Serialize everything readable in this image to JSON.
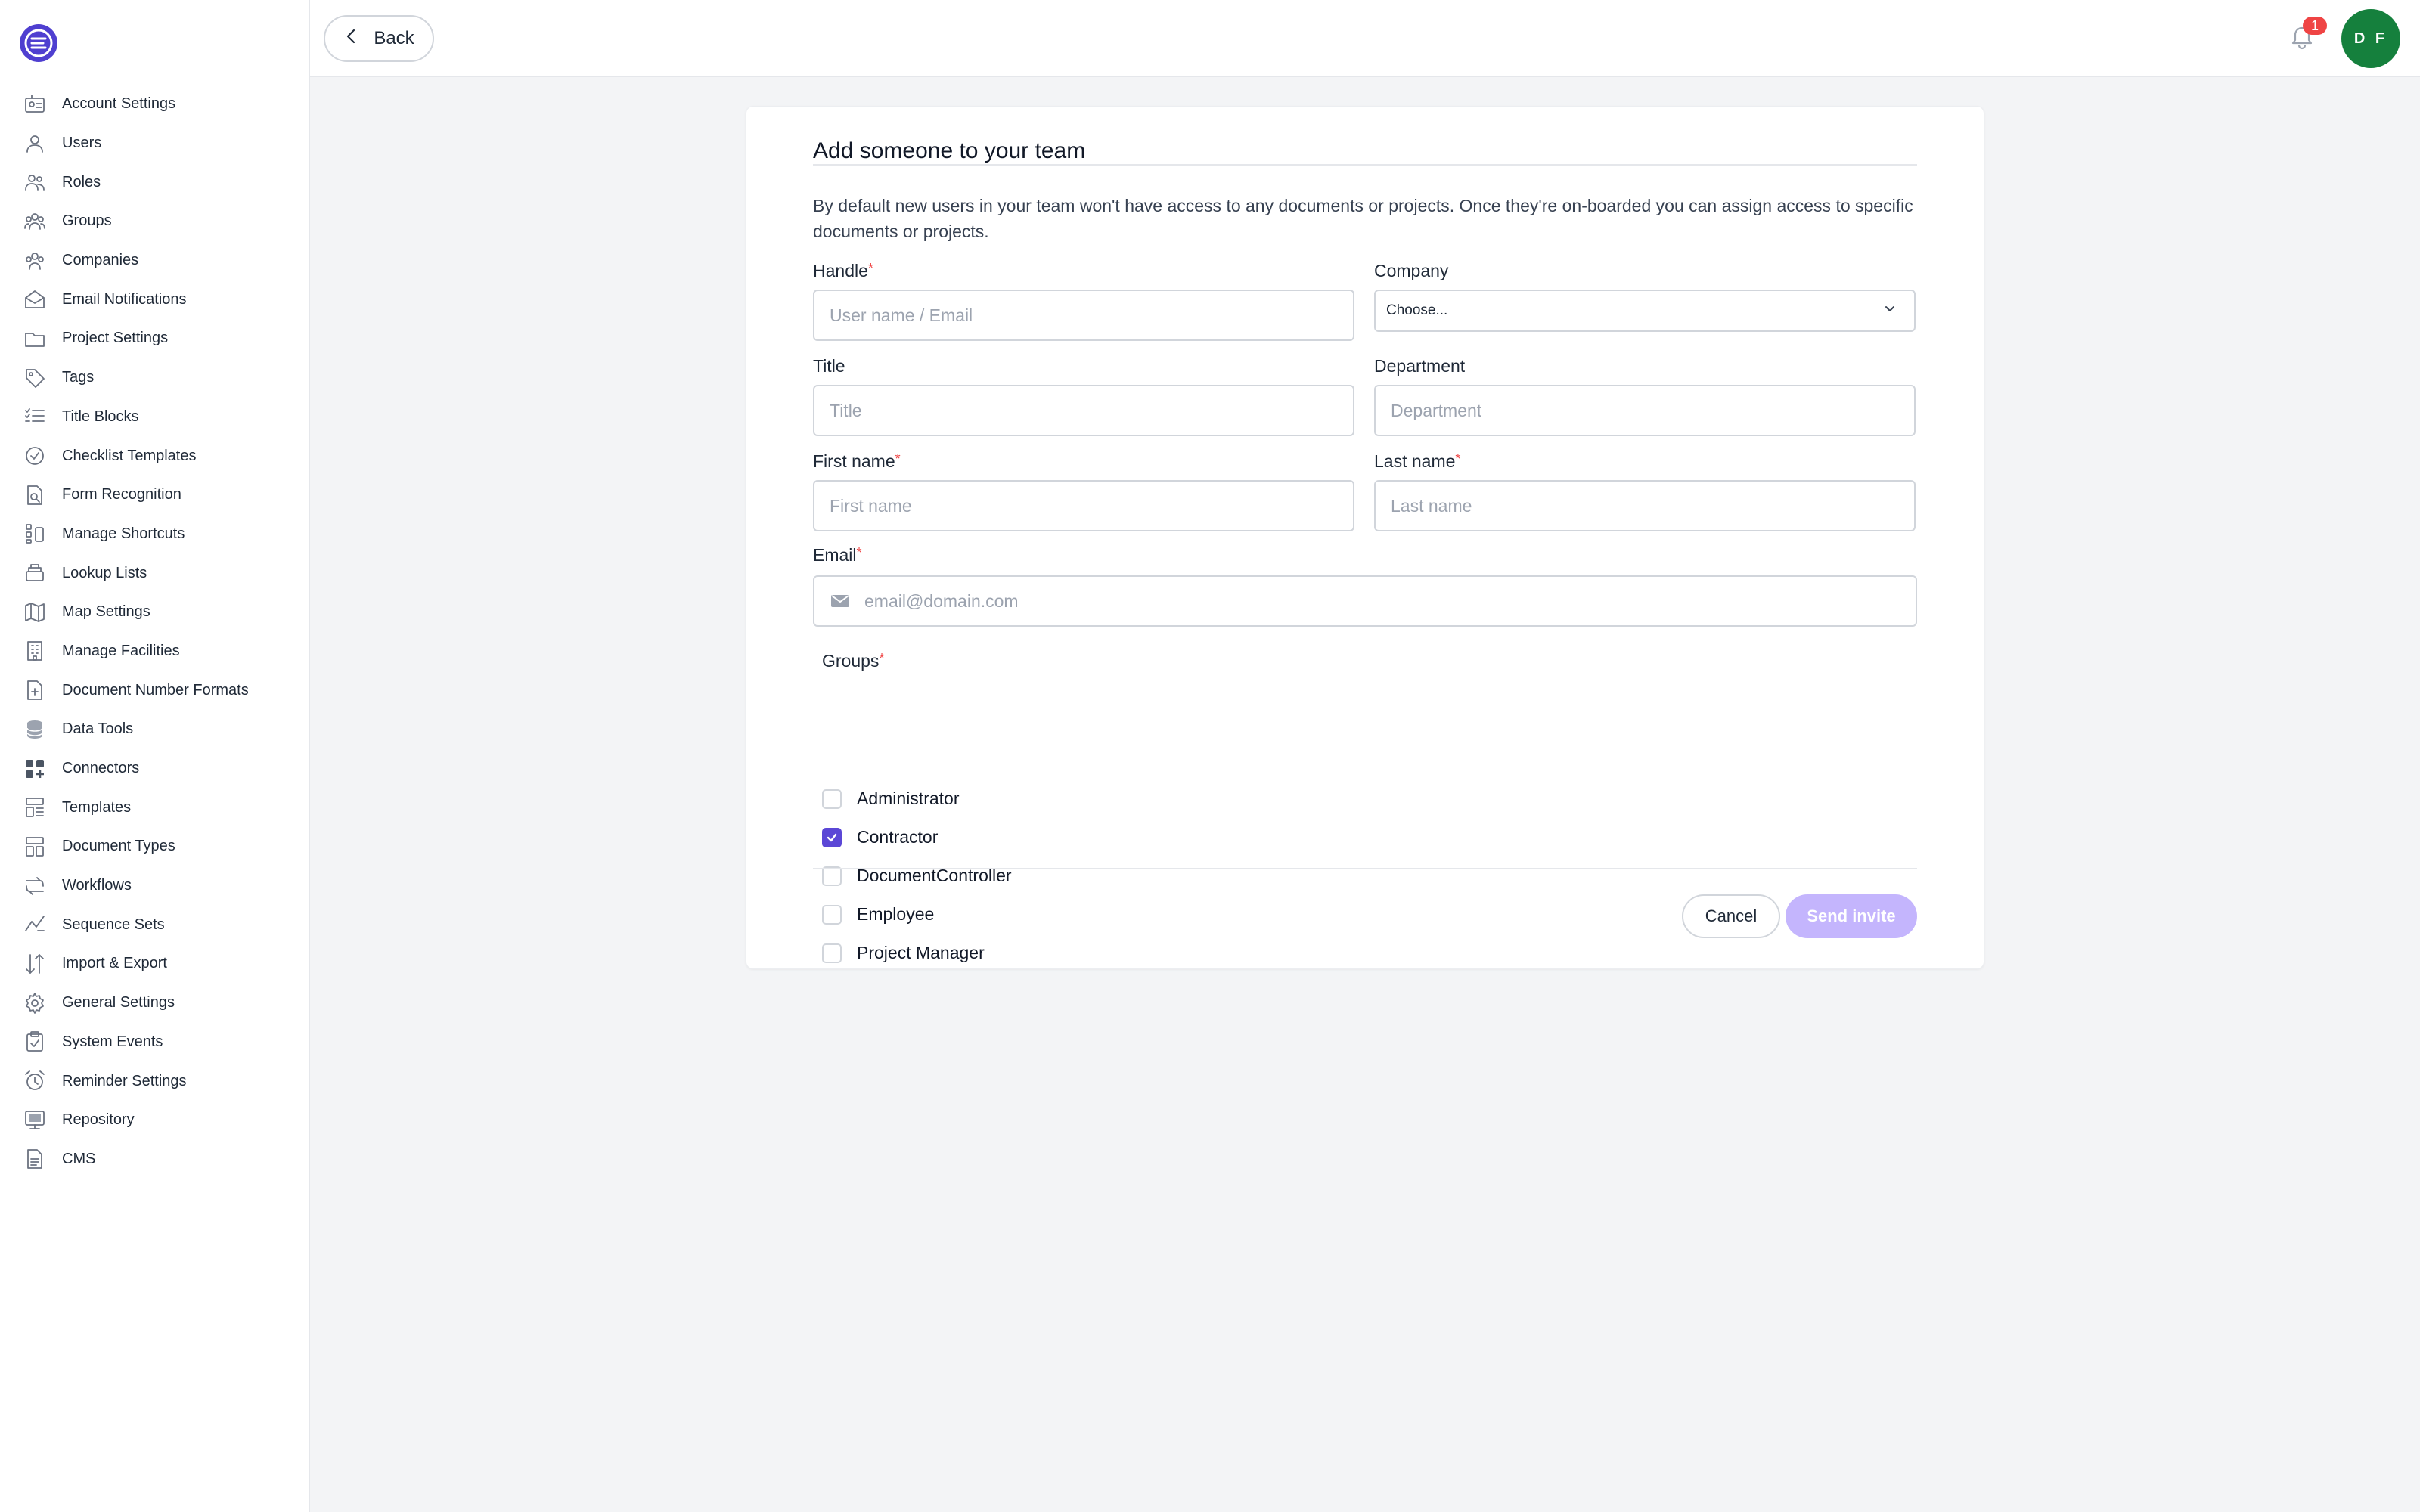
{
  "sidebar": {
    "items": [
      {
        "label": "Account Settings",
        "icon": "id-card-icon"
      },
      {
        "label": "Users",
        "icon": "user-icon"
      },
      {
        "label": "Roles",
        "icon": "users-icon"
      },
      {
        "label": "Groups",
        "icon": "users-group-icon"
      },
      {
        "label": "Companies",
        "icon": "building-users-icon"
      },
      {
        "label": "Email Notifications",
        "icon": "envelope-open-icon"
      },
      {
        "label": "Project Settings",
        "icon": "folder-icon"
      },
      {
        "label": "Tags",
        "icon": "tag-icon"
      },
      {
        "label": "Title Blocks",
        "icon": "list-check-icon"
      },
      {
        "label": "Checklist Templates",
        "icon": "check-circle-icon"
      },
      {
        "label": "Form Recognition",
        "icon": "file-search-icon"
      },
      {
        "label": "Manage Shortcuts",
        "icon": "shortcut-icon"
      },
      {
        "label": "Lookup Lists",
        "icon": "layers-icon"
      },
      {
        "label": "Map Settings",
        "icon": "map-icon"
      },
      {
        "label": "Manage Facilities",
        "icon": "building-icon"
      },
      {
        "label": "Document Number Formats",
        "icon": "file-plus-icon"
      },
      {
        "label": "Data Tools",
        "icon": "database-icon"
      },
      {
        "label": "Connectors",
        "icon": "apps-icon"
      },
      {
        "label": "Templates",
        "icon": "template-icon"
      },
      {
        "label": "Document Types",
        "icon": "doc-type-icon"
      },
      {
        "label": "Workflows",
        "icon": "workflow-icon"
      },
      {
        "label": "Sequence Sets",
        "icon": "sequence-icon"
      },
      {
        "label": "Import & Export",
        "icon": "import-export-icon"
      },
      {
        "label": "General Settings",
        "icon": "gear-icon"
      },
      {
        "label": "System Events",
        "icon": "clipboard-check-icon"
      },
      {
        "label": "Reminder Settings",
        "icon": "alarm-clock-icon"
      },
      {
        "label": "Repository",
        "icon": "repository-icon"
      },
      {
        "label": "CMS",
        "icon": "file-text-icon"
      }
    ]
  },
  "topbar": {
    "back_label": "Back",
    "notification_count": "1",
    "avatar_initials": "D F"
  },
  "form": {
    "title": "Add someone to your team",
    "intro": "By default new users in your team won't have access to any documents or projects. Once they're on-boarded you can assign access to specific documents or projects.",
    "handle": {
      "label": "Handle",
      "placeholder": "User name / Email",
      "required": true
    },
    "company": {
      "label": "Company",
      "selected": "Choose..."
    },
    "title_field": {
      "label": "Title",
      "placeholder": "Title"
    },
    "department": {
      "label": "Department",
      "placeholder": "Department"
    },
    "first_name": {
      "label": "First name",
      "placeholder": "First name",
      "required": true
    },
    "last_name": {
      "label": "Last name",
      "placeholder": "Last name",
      "required": true
    },
    "email": {
      "label": "Email",
      "placeholder": "email@domain.com",
      "required": true
    },
    "groups": {
      "label": "Groups",
      "options": [
        {
          "label": "Administrator",
          "checked": false
        },
        {
          "label": "Contractor",
          "checked": true
        },
        {
          "label": "DocumentController",
          "checked": false
        },
        {
          "label": "Employee",
          "checked": false
        },
        {
          "label": "Project Manager",
          "checked": false
        }
      ]
    },
    "required_mark": "*",
    "cancel_label": "Cancel",
    "send_label": "Send invite"
  },
  "colors": {
    "accent": "#5b47d6",
    "send_disabled": "#c4b5fd",
    "avatar": "#15803d",
    "badge": "#ef4444"
  }
}
